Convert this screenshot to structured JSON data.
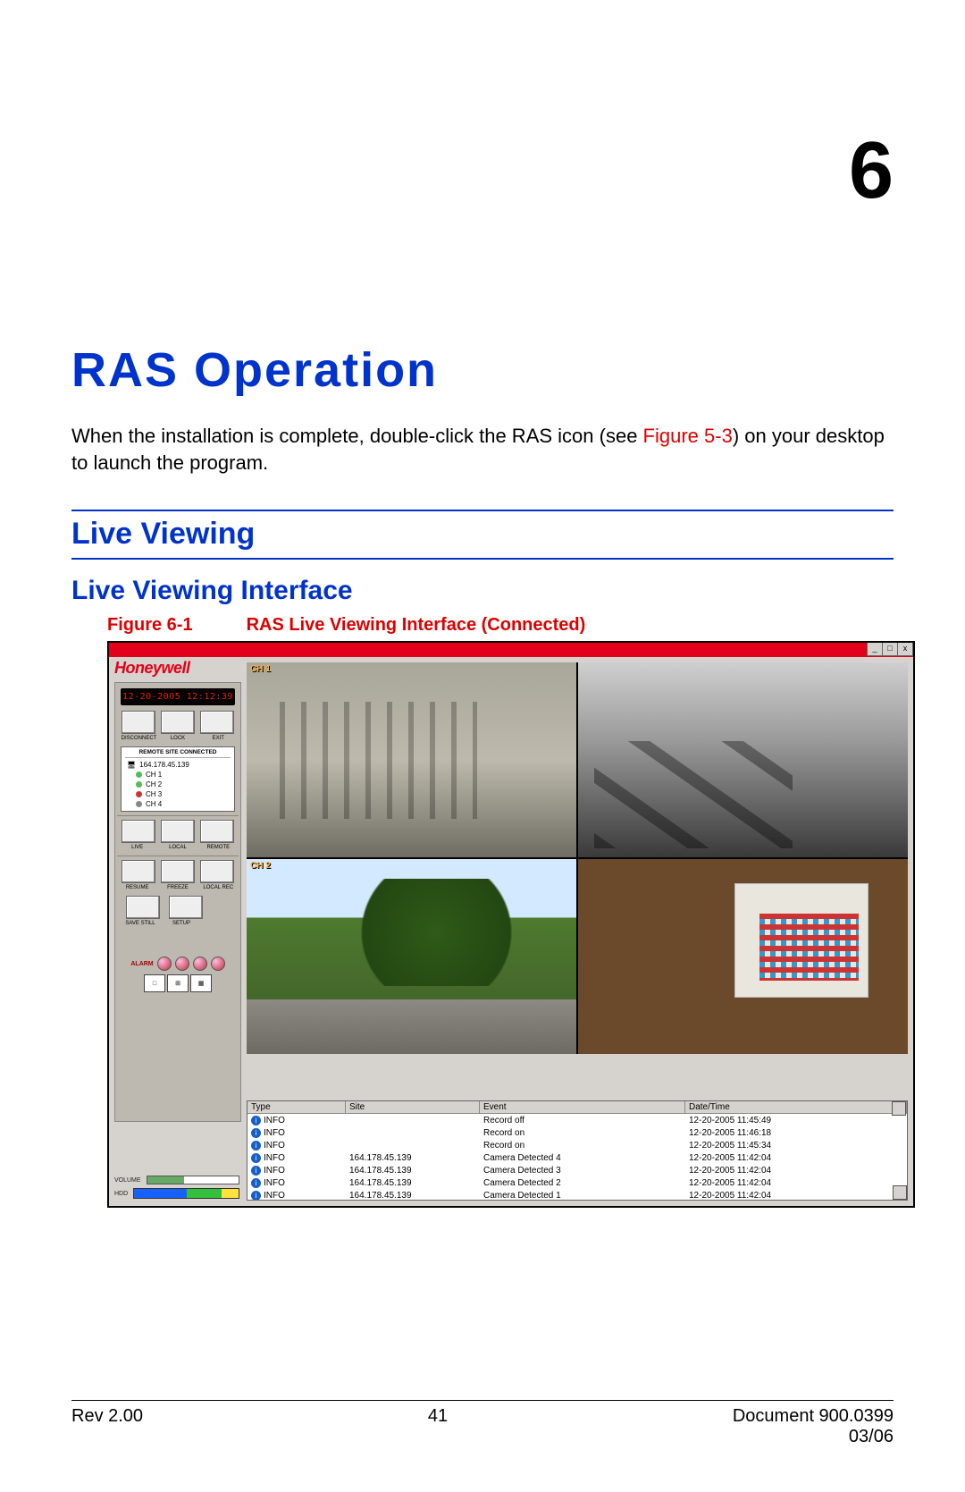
{
  "chapter_number": "6",
  "chapter_title": "RAS Operation",
  "intro": {
    "pre": "When the installation is complete, double-click the RAS icon (see ",
    "figref": "Figure 5-3",
    "post": ") on your desktop to launch the program."
  },
  "h2": "Live Viewing",
  "h3": "Live Viewing Interface",
  "figure": {
    "label": "Figure 6-1",
    "caption": "RAS Live Viewing Interface (Connected)"
  },
  "app": {
    "brand": "Honeywell",
    "timestamp": "12-20-2005 12:12:39",
    "window_buttons": {
      "min": "_",
      "max": "□",
      "close": "x"
    },
    "button_rows": [
      {
        "buttons": [
          "disconnect-button",
          "lock-button",
          "exit-button"
        ],
        "labels": [
          "DISCONNECT",
          "LOCK",
          "EXIT"
        ]
      },
      {
        "buttons": [
          "live-button",
          "local-button",
          "remote-button"
        ],
        "labels": [
          "LIVE",
          "LOCAL",
          "REMOTE"
        ]
      },
      {
        "buttons": [
          "resume-button",
          "freeze-button",
          "local-rec-button"
        ],
        "labels": [
          "RESUME",
          "FREEZE",
          "LOCAL REC"
        ]
      },
      {
        "buttons": [
          "save-still-button",
          "setup-button"
        ],
        "labels": [
          "SAVE STILL",
          "SETUP"
        ]
      }
    ],
    "tree": {
      "title": "REMOTE SITE CONNECTED",
      "ip": "164.178.45.139",
      "channels": [
        {
          "name": "CH 1",
          "state": "g"
        },
        {
          "name": "CH 2",
          "state": "g"
        },
        {
          "name": "CH 3",
          "state": "r"
        },
        {
          "name": "CH 4",
          "state": "gray"
        }
      ]
    },
    "alarm_label": "ALARM",
    "volume_label": "VOLUME",
    "hdd_label": "HDD",
    "cams": {
      "ch1": "CH 1",
      "ch2": "CH 2"
    },
    "log": {
      "headers": [
        "Type",
        "Site",
        "Event",
        "Date/Time"
      ],
      "rows": [
        {
          "type": "INFO",
          "site": "",
          "event": "Record off",
          "dt": "12-20-2005 11:45:49"
        },
        {
          "type": "INFO",
          "site": "",
          "event": "Record on",
          "dt": "12-20-2005 11:46:18"
        },
        {
          "type": "INFO",
          "site": "",
          "event": "Record on",
          "dt": "12-20-2005 11:45:34"
        },
        {
          "type": "INFO",
          "site": "164.178.45.139",
          "event": "Camera Detected 4",
          "dt": "12-20-2005 11:42:04"
        },
        {
          "type": "INFO",
          "site": "164.178.45.139",
          "event": "Camera Detected 3",
          "dt": "12-20-2005 11:42:04"
        },
        {
          "type": "INFO",
          "site": "164.178.45.139",
          "event": "Camera Detected 2",
          "dt": "12-20-2005 11:42:04"
        },
        {
          "type": "INFO",
          "site": "164.178.45.139",
          "event": "Camera Detected 1",
          "dt": "12-20-2005 11:42:04"
        }
      ]
    }
  },
  "footer": {
    "rev": "Rev 2.00",
    "page": "41",
    "doc": "Document 900.0399",
    "date": "03/06"
  }
}
